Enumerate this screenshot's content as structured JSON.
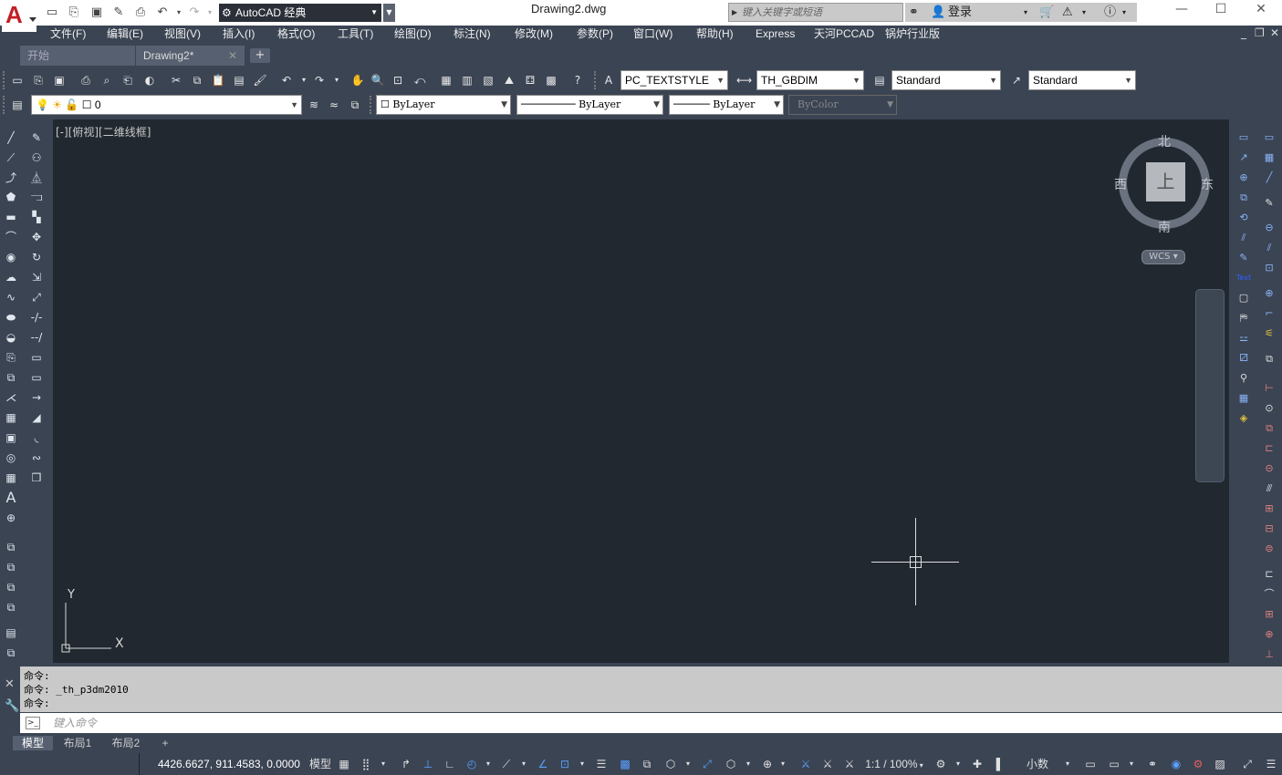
{
  "titlebar": {
    "workspace": "AutoCAD 经典",
    "document_title": "Drawing2.dwg",
    "search_placeholder": "键入关键字或短语",
    "login_label": "登录"
  },
  "menu": {
    "items": [
      "文件(F)",
      "编辑(E)",
      "视图(V)",
      "插入(I)",
      "格式(O)",
      "工具(T)",
      "绘图(D)",
      "标注(N)",
      "修改(M)",
      "参数(P)",
      "窗口(W)",
      "帮助(H)",
      "Express",
      "天河PCCAD",
      "锅炉行业版"
    ]
  },
  "tabs": {
    "start": "开始",
    "drawing": "Drawing2*",
    "add": "+"
  },
  "styles_toolbar": {
    "text_style": "PC_TEXTSTYLE",
    "dim_style": "TH_GBDIM",
    "table_style": "Standard",
    "mleader_style": "Standard"
  },
  "layers_toolbar": {
    "layer_name": "0",
    "color": "ByLayer",
    "linetype": "ByLayer",
    "lineweight": "ByLayer",
    "plot_style": "ByColor"
  },
  "viewport": {
    "label": "[-][俯视][二维线框]"
  },
  "viewcube": {
    "north": "北",
    "south": "南",
    "east": "东",
    "west": "西",
    "face": "上",
    "wcs": "WCS"
  },
  "ucs": {
    "x": "X",
    "y": "Y"
  },
  "command": {
    "history": [
      "命令:",
      "命令: _th_p3dm2010",
      "命令:"
    ],
    "input_placeholder": "键入命令"
  },
  "layout_tabs": [
    "模型",
    "布局1",
    "布局2"
  ],
  "statusbar": {
    "coordinates": "4426.6627, 911.4583, 0.0000",
    "model": "模型",
    "scale": "1:1 / 100%",
    "units": "小数"
  },
  "colors": {
    "background": "#3b4453",
    "viewport": "#212830",
    "accent_red": "#c21f26"
  }
}
